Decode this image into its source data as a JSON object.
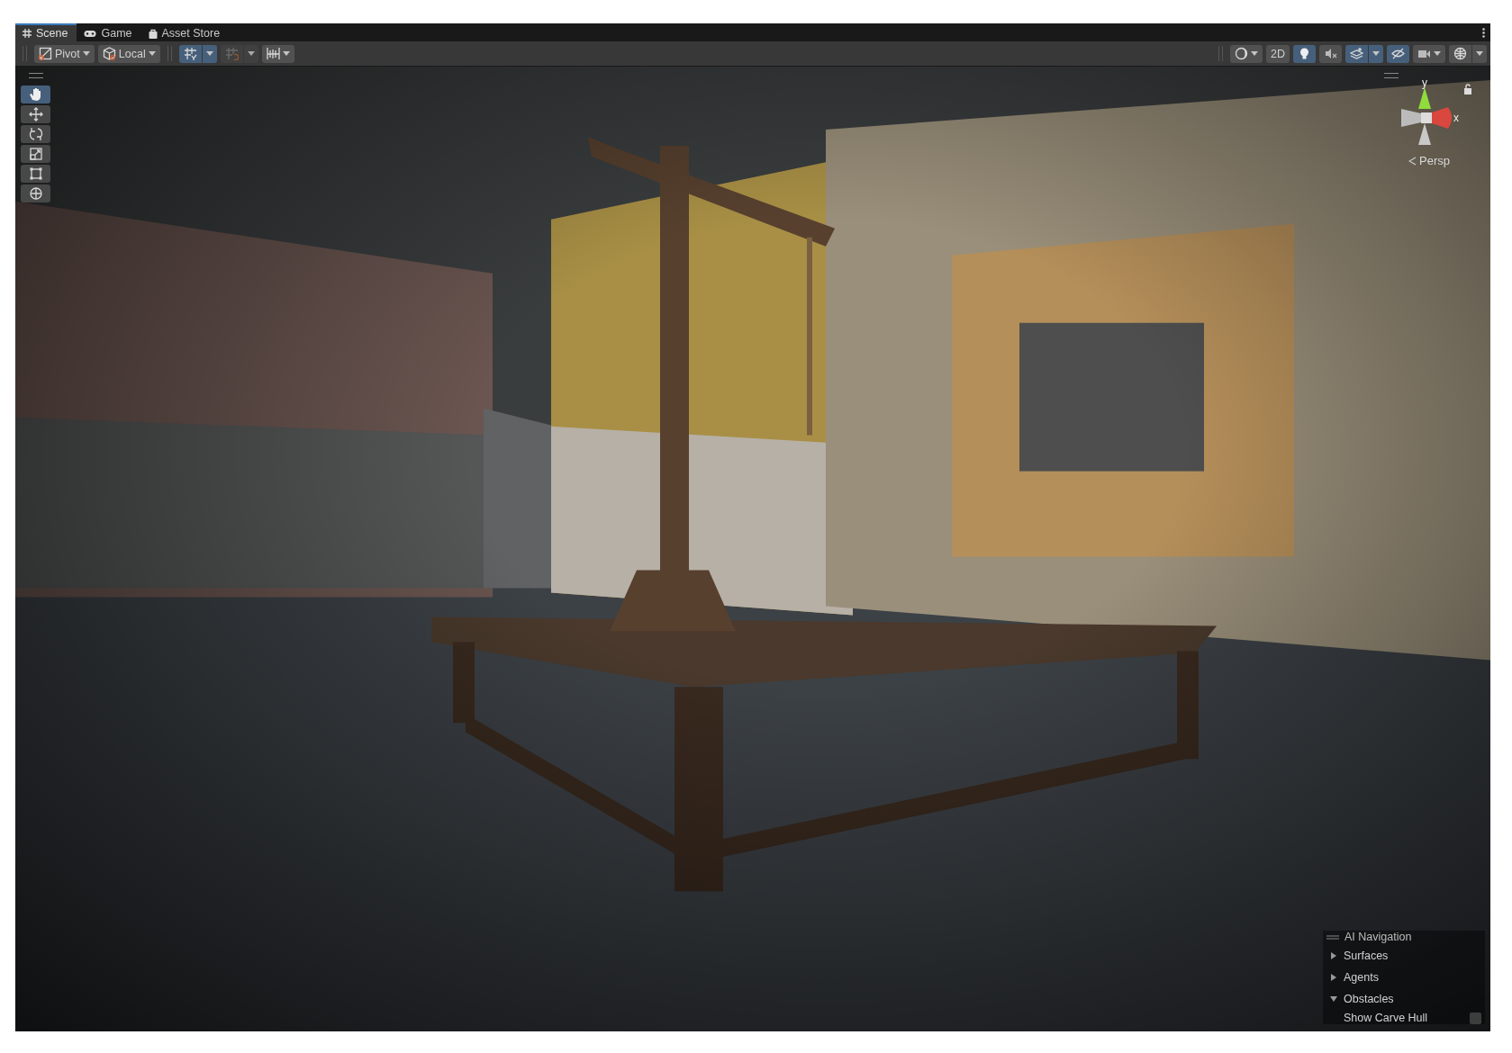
{
  "tabs": [
    {
      "label": "Scene",
      "kind": "scene",
      "selected": true
    },
    {
      "label": "Game",
      "kind": "game",
      "selected": false
    },
    {
      "label": "Asset Store",
      "kind": "store",
      "selected": false
    }
  ],
  "toolbar": {
    "left": [
      {
        "kind": "pivot",
        "label": "Pivot"
      },
      {
        "kind": "local",
        "label": "Local"
      },
      {
        "kind": "grid-snap",
        "on": true
      },
      {
        "kind": "increment-snap",
        "disabled": true
      },
      {
        "kind": "grid-ruler",
        "on": false
      }
    ],
    "right": [
      {
        "kind": "shading",
        "on": false
      },
      {
        "kind": "mode",
        "label": "2D",
        "on": false
      },
      {
        "kind": "lighting",
        "on": true
      },
      {
        "kind": "audio",
        "on": false
      },
      {
        "kind": "effects",
        "on": true
      },
      {
        "kind": "visibility",
        "on": true
      },
      {
        "kind": "camera",
        "on": false
      },
      {
        "kind": "gizmos",
        "on": false
      }
    ]
  },
  "tools": [
    {
      "kind": "hand",
      "selected": true
    },
    {
      "kind": "move",
      "selected": false
    },
    {
      "kind": "rotate",
      "selected": false
    },
    {
      "kind": "scale",
      "selected": false
    },
    {
      "kind": "rect",
      "selected": false
    },
    {
      "kind": "transform",
      "selected": false
    }
  ],
  "gizmo": {
    "axes": [
      "y",
      "x"
    ],
    "projection": "Persp"
  },
  "navigation_overlay": {
    "title": "AI Navigation",
    "items": [
      {
        "label": "Surfaces",
        "expanded": false
      },
      {
        "label": "Agents",
        "expanded": false
      },
      {
        "label": "Obstacles",
        "expanded": true,
        "children": [
          {
            "label": "Show Carve Hull",
            "checked": false
          }
        ]
      }
    ]
  }
}
